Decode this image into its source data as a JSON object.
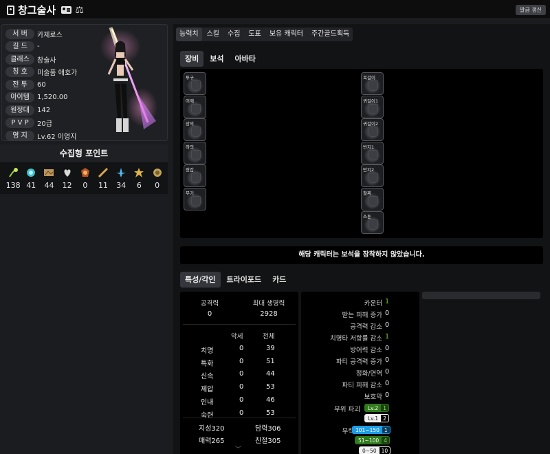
{
  "header": {
    "title": "창그술사",
    "refresh_label": "발급 갱신"
  },
  "profile": {
    "rows": [
      {
        "label": "서 버",
        "value": "카제로스"
      },
      {
        "label": "길 드",
        "value": "-"
      },
      {
        "label": "클래스",
        "value": "창술사"
      },
      {
        "label": "칭 호",
        "value": "미술품 애호가"
      },
      {
        "label": "전 투",
        "value": "60"
      },
      {
        "label": "아이템",
        "value": "1,520.00"
      },
      {
        "label": "원정대",
        "value": "142"
      },
      {
        "label": "P V P",
        "value": "20급"
      },
      {
        "label": "영 지",
        "value": "Lv.62 이영지"
      }
    ]
  },
  "collect": {
    "title": "수집형 포인트",
    "items": [
      {
        "icon": "mokoko-seed-icon",
        "value": "138"
      },
      {
        "icon": "island-heart-icon",
        "value": "41"
      },
      {
        "icon": "masterpiece-icon",
        "value": "44"
      },
      {
        "icon": "giant-heart-icon",
        "value": "12"
      },
      {
        "icon": "ignea-token-icon",
        "value": "0"
      },
      {
        "icon": "adventure-icon",
        "value": "11"
      },
      {
        "icon": "world-tree-leaf-icon",
        "value": "34"
      },
      {
        "icon": "orpheus-star-icon",
        "value": "6"
      },
      {
        "icon": "sea-bounty-icon",
        "value": "0"
      }
    ]
  },
  "main_tabs": [
    "능력치",
    "스킬",
    "수집",
    "도표",
    "보유 캐릭터",
    "주간골드획득"
  ],
  "sub_tabs": [
    "장비",
    "보석",
    "아바타"
  ],
  "equipment": {
    "left": [
      "투구",
      "어깨",
      "상의",
      "하의",
      "장갑",
      "무기"
    ],
    "right": [
      "목걸이",
      "귀걸이1",
      "귀걸이2",
      "반지1",
      "반지2",
      "팔찌",
      "스톤"
    ]
  },
  "gem_message": "해당 캐릭터는 보석을 장착하지 않았습니다.",
  "lower_tabs": [
    "특성/각인",
    "트라이포드",
    "카드"
  ],
  "stats": {
    "attack_label": "공격력",
    "attack_value": "0",
    "hp_label": "최대 생명력",
    "hp_value": "2928",
    "col_imprint": "악세",
    "col_total": "전체",
    "combat": [
      {
        "name": "치명",
        "acc": "0",
        "total": "39"
      },
      {
        "name": "특화",
        "acc": "0",
        "total": "51"
      },
      {
        "name": "신속",
        "acc": "0",
        "total": "44"
      },
      {
        "name": "제압",
        "acc": "0",
        "total": "53"
      },
      {
        "name": "인내",
        "acc": "0",
        "total": "46"
      },
      {
        "name": "숙련",
        "acc": "0",
        "total": "53"
      }
    ],
    "attrs": [
      {
        "name": "지성",
        "value": "320"
      },
      {
        "name": "담력",
        "value": "306"
      },
      {
        "name": "매력",
        "value": "265"
      },
      {
        "name": "친절",
        "value": "305"
      }
    ]
  },
  "engrave": {
    "rows": [
      {
        "label": "카운터",
        "value": "1"
      },
      {
        "label": "받는 피해 증가",
        "value": "0"
      },
      {
        "label": "공격력 감소",
        "value": "0"
      },
      {
        "label": "치명타 저항률 감소",
        "value": "1"
      },
      {
        "label": "방어력 감소",
        "value": "0"
      },
      {
        "label": "파티 공격력 증가",
        "value": "0"
      },
      {
        "label": "정화/면역",
        "value": "0"
      },
      {
        "label": "파티 피해 감소",
        "value": "0"
      },
      {
        "label": "보호막",
        "value": "0"
      }
    ],
    "part_break_label": "부위 파괴",
    "part_break": [
      {
        "tier": "Lv.2",
        "count": "1"
      },
      {
        "tier": "Lv.1",
        "count": "2"
      }
    ],
    "stagger_label": "무력화",
    "stagger": [
      {
        "tier": "101~150",
        "count": "1"
      },
      {
        "tier": "51~100",
        "count": "4"
      },
      {
        "tier": "0~50",
        "count": "10"
      }
    ],
    "colors": {
      "green": "#7ed321",
      "blue": "#1d9ce6",
      "dark_green": "#2f7a1b"
    }
  }
}
